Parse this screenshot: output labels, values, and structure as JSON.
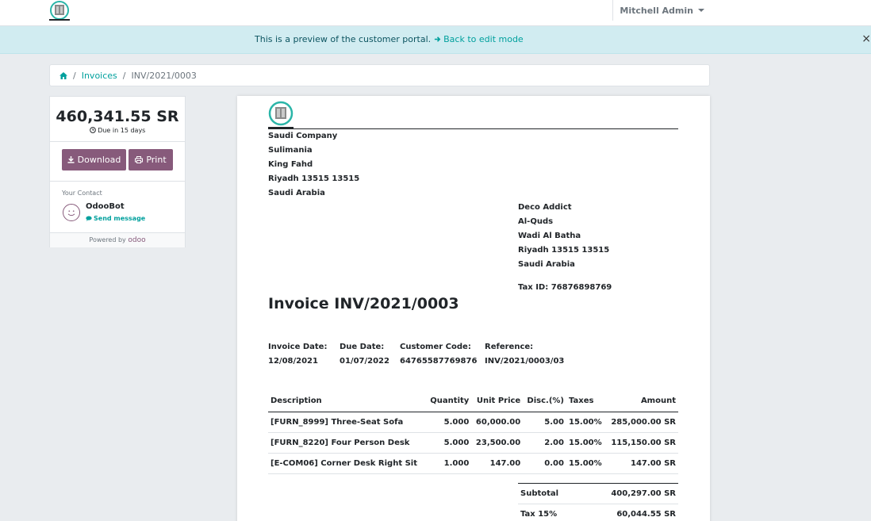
{
  "navbar": {
    "user_name": "Mitchell Admin"
  },
  "banner": {
    "text": "This is a preview of the customer portal.",
    "link": "Back to edit mode",
    "close": "×"
  },
  "breadcrumb": {
    "items": [
      "Invoices",
      "INV/2021/0003"
    ]
  },
  "sidebar": {
    "amount": "460,341.55 SR",
    "due": "Due in 15 days",
    "download_label": "Download",
    "print_label": "Print",
    "contact_label": "Your Contact",
    "contact_name": "OdooBot",
    "send_message": "Send message",
    "powered_by": "Powered by",
    "powered_brand": "odoo"
  },
  "invoice": {
    "company": [
      "Saudi Company",
      "Sulimania",
      "King Fahd",
      "Riyadh 13515 13515",
      "Saudi Arabia"
    ],
    "partner": [
      "Deco Addict",
      "Al-Quds",
      "Wadi Al Batha",
      "Riyadh 13515 13515",
      "Saudi Arabia"
    ],
    "tax_id": "Tax ID: 76876898769",
    "title": "Invoice INV/2021/0003",
    "info": [
      {
        "label": "Invoice Date:",
        "value": "12/08/2021"
      },
      {
        "label": "Due Date:",
        "value": "01/07/2022"
      },
      {
        "label": "Customer Code:",
        "value": "64765587769876"
      },
      {
        "label": "Reference:",
        "value": "INV/2021/0003/03"
      }
    ],
    "columns": [
      "Description",
      "Quantity",
      "Unit Price",
      "Disc.(%)",
      "Taxes",
      "Amount"
    ],
    "lines": [
      [
        "[FURN_8999] Three-Seat Sofa",
        "5.000",
        "60,000.00",
        "5.00",
        "15.00%",
        "285,000.00 SR"
      ],
      [
        "[FURN_8220] Four Person Desk",
        "5.000",
        "23,500.00",
        "2.00",
        "15.00%",
        "115,150.00 SR"
      ],
      [
        "[E-COM06] Corner Desk Right Sit",
        "1.000",
        "147.00",
        "0.00",
        "15.00%",
        "147.00 SR"
      ]
    ],
    "totals": [
      {
        "label": "Subtotal",
        "value": "400,297.00 SR"
      },
      {
        "label": "Tax 15%",
        "value": "60,044.55 SR"
      }
    ]
  },
  "colors": {
    "primary": "#875a7b",
    "link": "#00a09d",
    "banner_bg": "#d1ecf1"
  }
}
